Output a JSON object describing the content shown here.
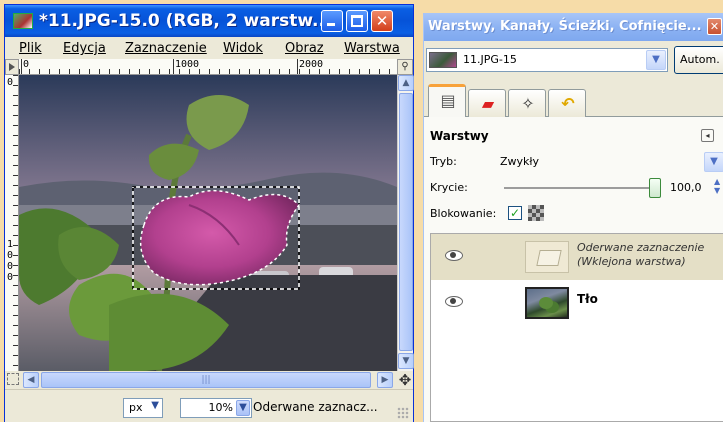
{
  "image_window": {
    "title": "*11.JPG-15.0 (RGB, 2 warstw...",
    "window_buttons": {
      "minimize_icon": "minimize-icon",
      "maximize_icon": "maximize-icon",
      "close_icon": "close-icon",
      "close_glyph": "✕"
    },
    "menu": [
      "Plik",
      "Edycja",
      "Zaznaczenie",
      "Widok",
      "Obraz",
      "Warstwa"
    ],
    "ruler_h_labels": [
      "0",
      "1000",
      "2000"
    ],
    "ruler_v_labels": [
      "0",
      "1",
      "0",
      "0",
      "0"
    ],
    "status": {
      "unit": "px",
      "zoom": "10%",
      "message": "Oderwane zaznacz..."
    }
  },
  "layers_dock": {
    "title": "Warstwy, Kanały, Ścieżki, Cofnięcie...",
    "close_glyph": "✕",
    "image_selector": "11.JPG-15",
    "auto_button": "Autom.",
    "tabs": [
      {
        "name": "layers",
        "icon": "layers-icon",
        "glyph": "▤"
      },
      {
        "name": "channels",
        "icon": "channels-icon",
        "glyph": "▰"
      },
      {
        "name": "paths",
        "icon": "paths-icon",
        "glyph": "✧"
      },
      {
        "name": "undo",
        "icon": "undo-icon",
        "glyph": "↶"
      }
    ],
    "panel": {
      "heading": "Warstwy",
      "mode_label": "Tryb:",
      "mode_value": "Zwykły",
      "opacity_label": "Krycie:",
      "opacity_value": "100,0",
      "opacity_level": 1.0,
      "lock_label": "Blokowanie:",
      "lock_checked": true
    },
    "layers": [
      {
        "name": "Oderwane zaznaczenie (Wklejona warstwa)",
        "floating": true,
        "visible": true,
        "selected": true
      },
      {
        "name": "Tło",
        "floating": false,
        "visible": true,
        "selected": false
      }
    ]
  },
  "colors": {
    "background": "#f6dca8",
    "xp_title_blue": "#0653d8",
    "dock_title_blue": "#8db3f3",
    "close_red": "#d23e1a"
  }
}
